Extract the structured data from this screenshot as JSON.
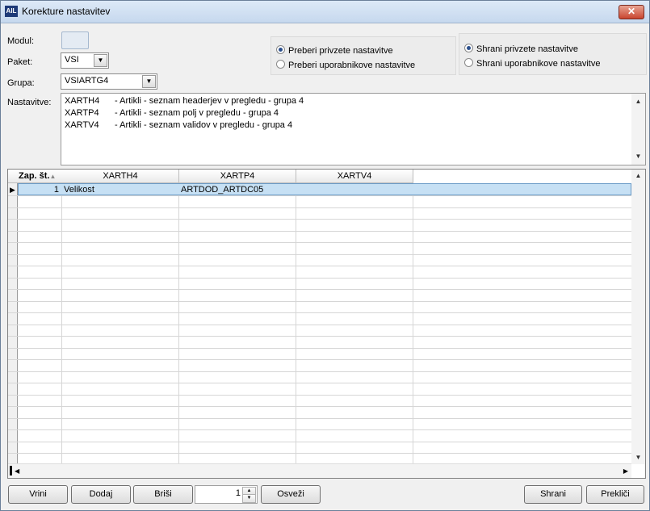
{
  "window": {
    "title": "Korekture nastavitev",
    "close": "✕",
    "app_icon": "AIL"
  },
  "form": {
    "modul_label": "Modul:",
    "paket_label": "Paket:",
    "paket_value": "VSI",
    "grupa_label": "Grupa:",
    "grupa_value": "VSIARTG4",
    "nastavitve_label": "Nastavitve:"
  },
  "read_group": {
    "options": [
      "Preberi privzete nastavitve",
      "Preberi uporabnikove nastavitve"
    ],
    "selected": 0
  },
  "save_group": {
    "options": [
      "Shrani privzete nastavitve",
      "Shrani uporabnikove nastavitve"
    ],
    "selected": 0
  },
  "memo_lines": [
    {
      "code": "XARTH4",
      "text": "- Artikli - seznam headerjev v pregledu - grupa 4"
    },
    {
      "code": "XARTP4",
      "text": "- Artikli - seznam polj v pregledu - grupa 4"
    },
    {
      "code": "XARTV4",
      "text": "- Artikli - seznam validov v pregledu - grupa 4"
    }
  ],
  "grid": {
    "columns": [
      "Zap. št.",
      "XARTH4",
      "XARTP4",
      "XARTV4"
    ],
    "sort_indicator": "▲",
    "rows": [
      {
        "zap": "1",
        "xarth4": "Velikost",
        "xartp4": "ARTDOD_ARTDC05",
        "xartv4": ""
      }
    ]
  },
  "buttons": {
    "vrini": "Vrini",
    "dodaj": "Dodaj",
    "brisi": "Briši",
    "osvezi": "Osveži",
    "shrani": "Shrani",
    "preklici": "Prekliči"
  },
  "spinner_value": "1",
  "icons": {
    "dropdown": "chevron-down-icon",
    "scroll_up": "arrow-up-icon",
    "scroll_down": "arrow-down-icon",
    "scroll_left": "arrow-left-icon",
    "scroll_right": "arrow-right-icon",
    "row_pointer": "row-pointer-icon"
  },
  "colors": {
    "selected_row": "#c6e0f4",
    "title_bar": "#c6d8ee",
    "close_button": "#c9452f"
  }
}
